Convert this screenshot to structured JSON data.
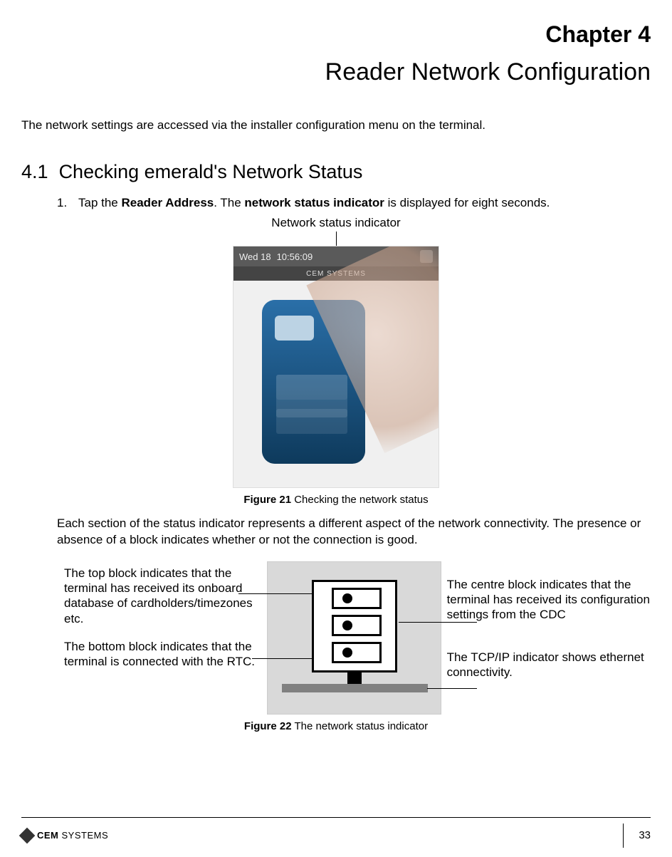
{
  "chapter_label": "Chapter 4",
  "chapter_title": "Reader Network Configuration",
  "intro": "The network settings are accessed via the installer configuration menu on the terminal.",
  "section": {
    "number": "4.1",
    "title": "Checking emerald's Network Status"
  },
  "step1": {
    "number": "1.",
    "pre": "Tap the ",
    "bold1": "Reader Address",
    "mid": ". The ",
    "bold2": "network status indicator",
    "post": " is displayed for eight seconds."
  },
  "indicator_label": "Network status indicator",
  "screenshot": {
    "date": "Wed 18",
    "time": "10:56:09",
    "brand": "CEM SYSTEMS"
  },
  "figure21": {
    "label": "Figure 21",
    "caption": " Checking the network status"
  },
  "para": "Each section of the status indicator represents a different aspect of the network connectivity. The presence or absence of a block indicates whether or not the connection is good.",
  "labels": {
    "top_block": "The top block indicates that the terminal has received its onboard database of cardholders/timezones etc.",
    "bottom_block": "The bottom block indicates that the terminal is connected with the RTC.",
    "centre_block": "The centre block indicates that the terminal has received its configuration settings from the CDC",
    "tcpip": "The TCP/IP indicator shows ethernet connectivity."
  },
  "figure22": {
    "label": "Figure 22",
    "caption": " The network status indicator"
  },
  "footer": {
    "brand_strong": "CEM",
    "brand_light": " SYSTEMS",
    "page": "33"
  }
}
